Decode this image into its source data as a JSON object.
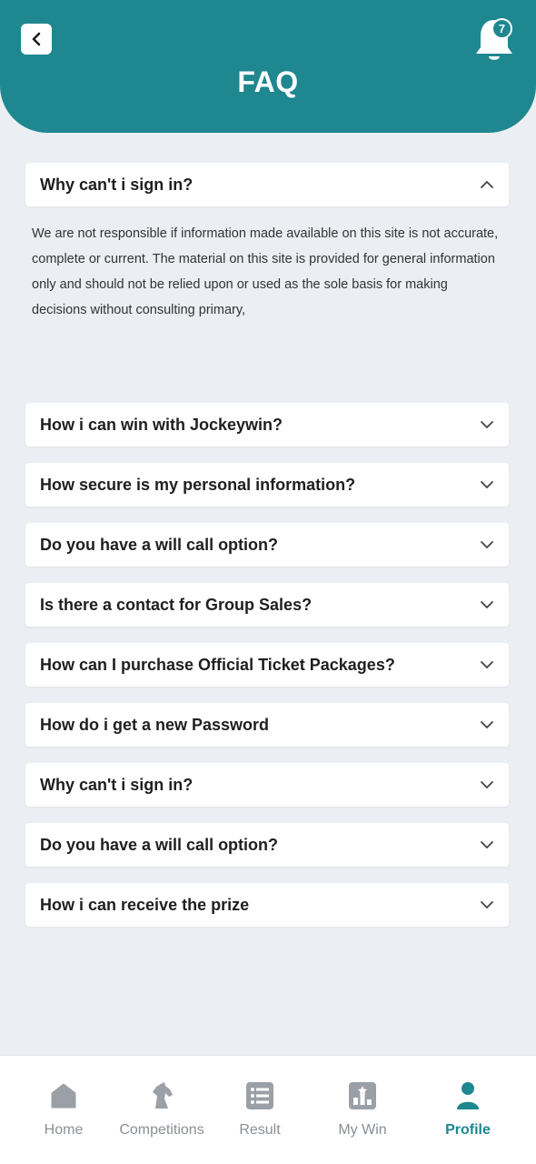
{
  "header": {
    "title": "FAQ",
    "notification_count": "7",
    "back_icon": "chevron-left-icon",
    "bell_icon": "bell-icon",
    "accent_color": "#1e8790"
  },
  "faq": {
    "expanded": {
      "question": "Why can't i sign in?",
      "answer": "We are not responsible if information made available on this site is not accurate, complete or current. The material on this site is provided for general information only and should not be relied upon or used as the sole basis for making decisions without consulting primary,"
    },
    "items": [
      {
        "question": "How i can win with Jockeywin?"
      },
      {
        "question": "How secure is my personal information?"
      },
      {
        "question": "Do you have a will call option?"
      },
      {
        "question": "Is there a contact for Group Sales?"
      },
      {
        "question": "How can I purchase Official Ticket Packages?"
      },
      {
        "question": "How do i get a new Password"
      },
      {
        "question": "Why can't i sign in?"
      },
      {
        "question": "Do you have a will call option?"
      },
      {
        "question": "How i can receive the prize"
      }
    ]
  },
  "tabbar": {
    "tabs": [
      {
        "label": "Home",
        "icon": "home-icon"
      },
      {
        "label": "Competitions",
        "icon": "horse-icon"
      },
      {
        "label": "Result",
        "icon": "list-icon"
      },
      {
        "label": "My Win",
        "icon": "trophy-icon"
      },
      {
        "label": "Profile",
        "icon": "user-icon"
      }
    ],
    "active": "Profile"
  }
}
